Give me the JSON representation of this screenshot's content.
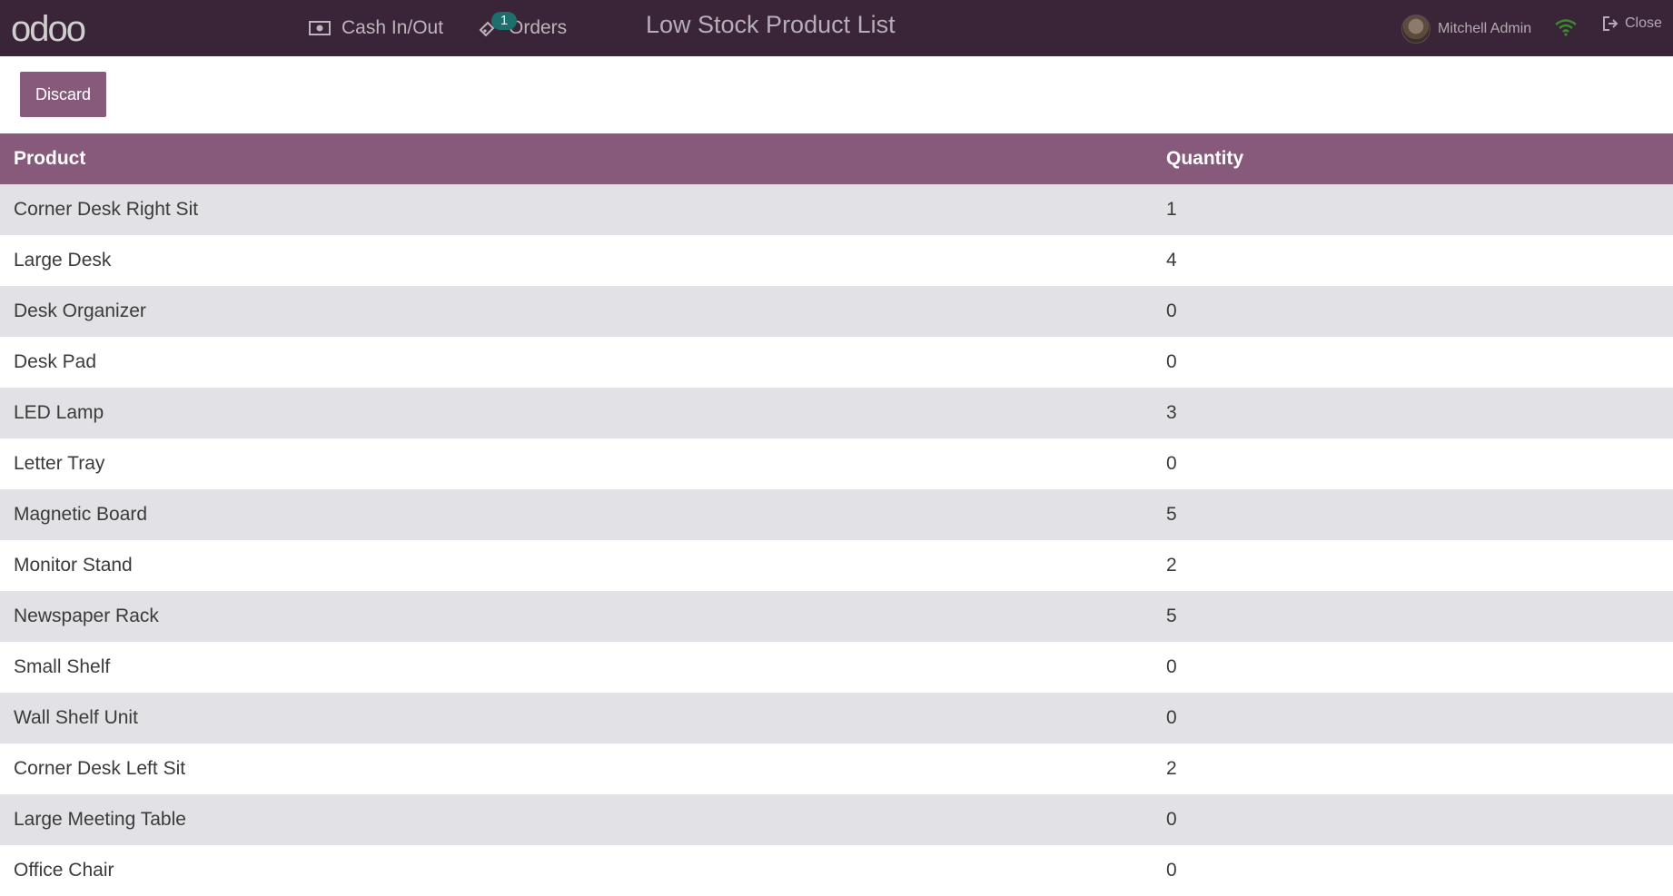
{
  "header": {
    "logo": "odoo",
    "cash_label": "Cash In/Out",
    "orders_label": "Orders",
    "orders_badge": "1",
    "title": "Low Stock Product List",
    "user_name": "Mitchell Admin",
    "close_label": "Close",
    "wifi_color": "#3c8a2e",
    "bar_color": "#3a2437"
  },
  "toolbar": {
    "discard_label": "Discard",
    "accent": "#875a7b"
  },
  "table": {
    "columns": [
      "Product",
      "Quantity"
    ],
    "rows": [
      {
        "product": "Corner Desk Right Sit",
        "qty": "1"
      },
      {
        "product": "Large Desk",
        "qty": "4"
      },
      {
        "product": "Desk Organizer",
        "qty": "0"
      },
      {
        "product": "Desk Pad",
        "qty": "0"
      },
      {
        "product": "LED Lamp",
        "qty": "3"
      },
      {
        "product": "Letter Tray",
        "qty": "0"
      },
      {
        "product": "Magnetic Board",
        "qty": "5"
      },
      {
        "product": "Monitor Stand",
        "qty": "2"
      },
      {
        "product": "Newspaper Rack",
        "qty": "5"
      },
      {
        "product": "Small Shelf",
        "qty": "0"
      },
      {
        "product": "Wall Shelf Unit",
        "qty": "0"
      },
      {
        "product": "Corner Desk Left Sit",
        "qty": "2"
      },
      {
        "product": "Large Meeting Table",
        "qty": "0"
      },
      {
        "product": "Office Chair",
        "qty": "0"
      }
    ]
  },
  "icons": {
    "cash": "money-bill-icon",
    "orders": "ticket-icon",
    "avatar": "user-avatar",
    "wifi": "wifi-icon",
    "close": "sign-out-icon"
  }
}
